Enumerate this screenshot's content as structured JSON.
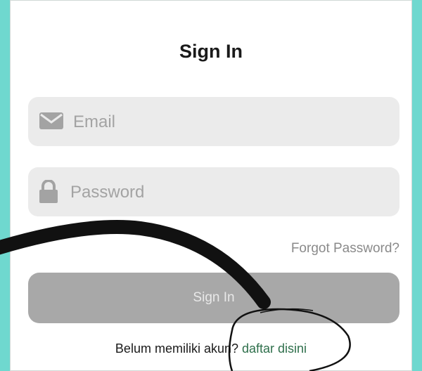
{
  "header": {
    "title": "Sign In"
  },
  "form": {
    "email": {
      "placeholder": "Email",
      "icon": "envelope-icon"
    },
    "password": {
      "placeholder": "Password",
      "icon": "lock-icon"
    },
    "forgot_label": "Forgot Password?",
    "submit_label": "Sign In"
  },
  "footer": {
    "prompt": "Belum memiliki akun?",
    "register_link": "daftar disini"
  },
  "colors": {
    "background": "#6fd8cf",
    "field_bg": "#ebebeb",
    "button_bg": "#a8a8a8",
    "link": "#2e6f4b"
  }
}
